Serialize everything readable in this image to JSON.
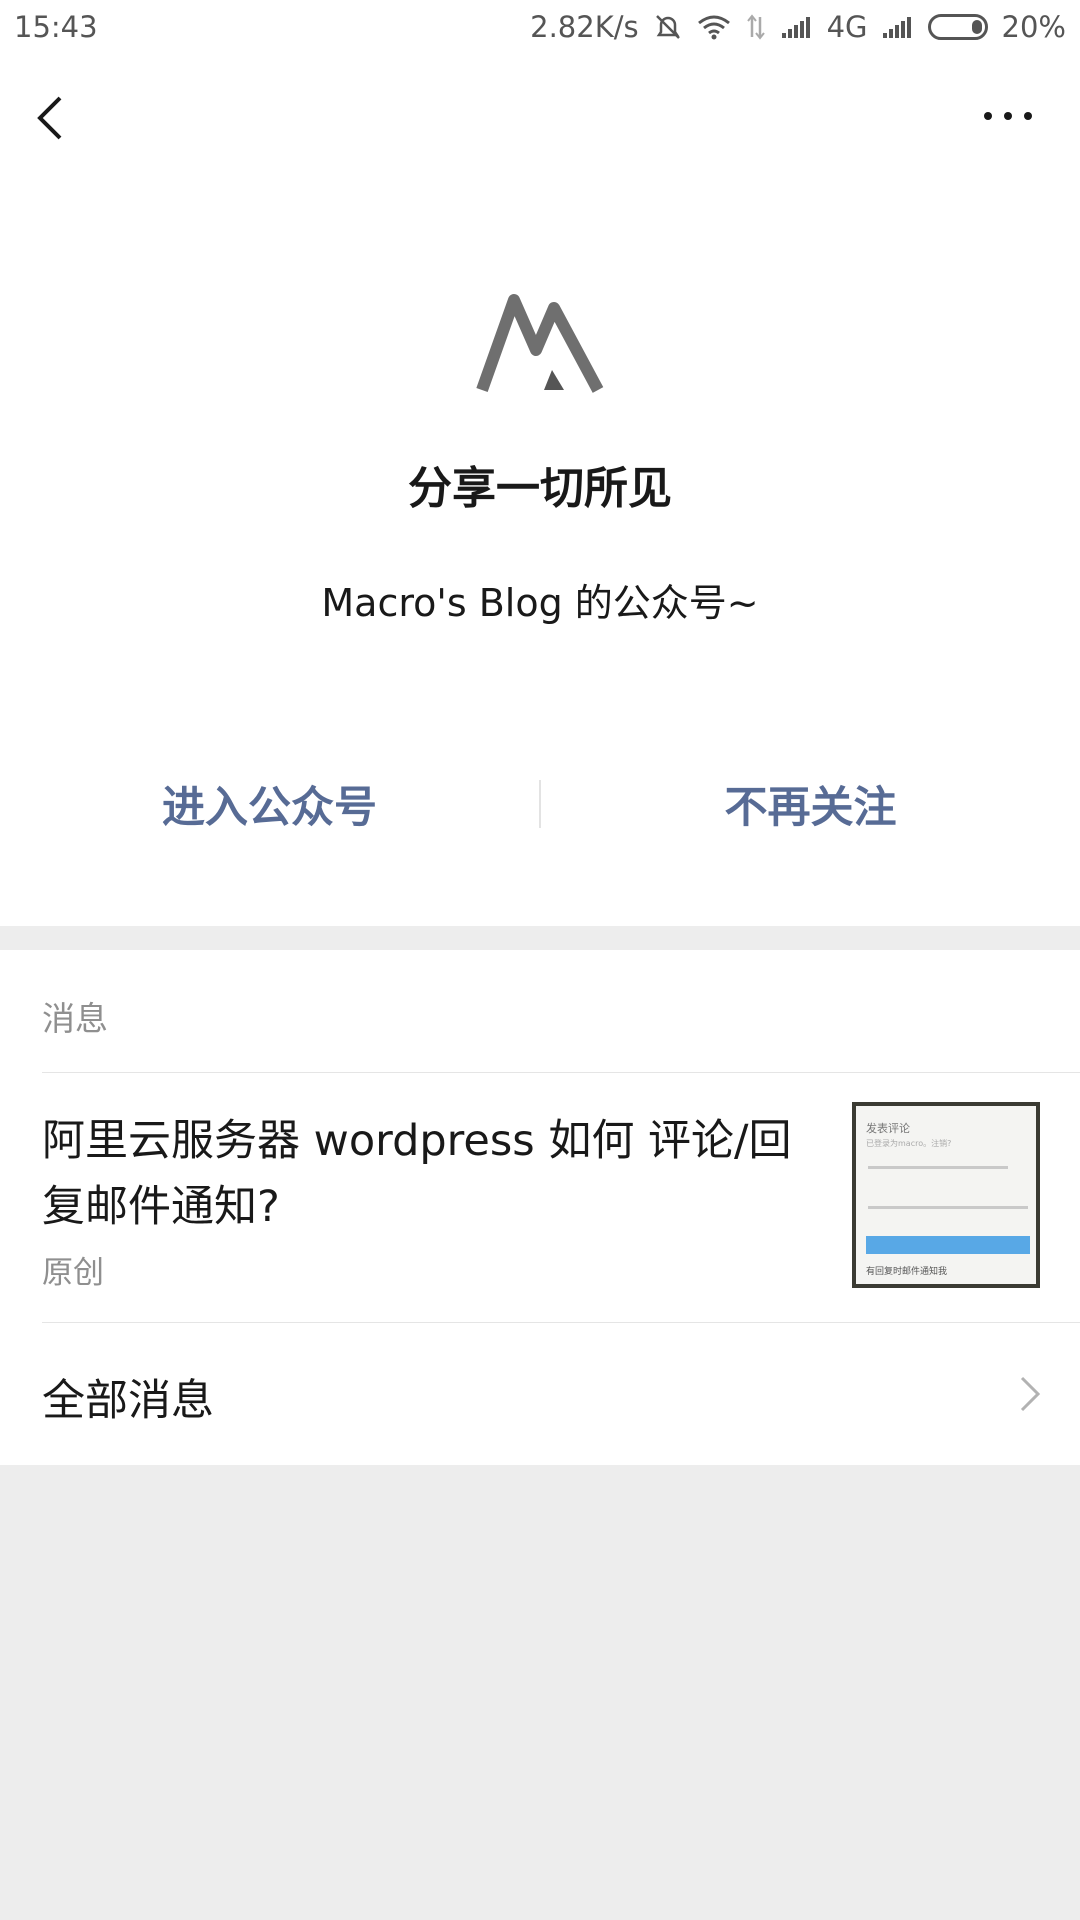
{
  "status_bar": {
    "time": "15:43",
    "net_speed": "2.82K/s",
    "network": "4G",
    "battery": "20%",
    "icons": [
      "mute-icon",
      "wifi-icon",
      "data-arrows-icon",
      "signal-icon",
      "signal-icon",
      "battery-icon"
    ]
  },
  "nav": {
    "back_icon": "chevron-left-icon",
    "more_icon": "more-dots-icon"
  },
  "account": {
    "name": "分享一切所见",
    "description": "Macro's Blog 的公众号~"
  },
  "actions": {
    "enter": "进入公众号",
    "unfollow": "不再关注"
  },
  "colors": {
    "link": "#576b95",
    "background": "#ededed",
    "panel": "#ffffff"
  },
  "messages": {
    "section_label": "消息",
    "article": {
      "title": "阿里云服务器 wordpress 如何 评论/回复邮件通知?",
      "tag": "原创",
      "thumbnail": {
        "heading": "发表评论",
        "line1": "已登录为macro。注销?",
        "checkbox_label": "有回复时邮件通知我"
      }
    },
    "all_label": "全部消息"
  }
}
